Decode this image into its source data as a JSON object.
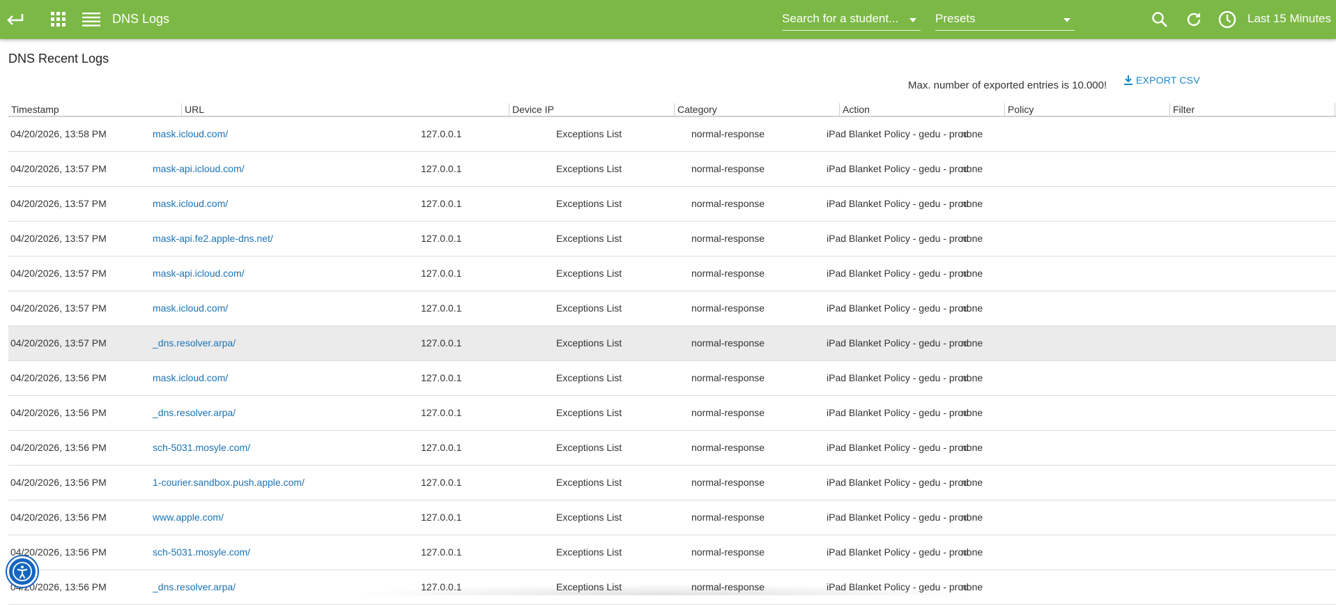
{
  "header": {
    "app_title": "DNS Logs",
    "student_search": {
      "placeholder": "Search for a student..."
    },
    "presets": {
      "value": "Presets"
    },
    "time_range": "Last 15 Minutes",
    "icons": [
      "back-arrow-icon",
      "apps-grid-icon",
      "list-menu-icon",
      "search-icon",
      "refresh-icon",
      "clock-icon"
    ],
    "bar_color": "#7cb845"
  },
  "page": {
    "title": "DNS Recent Logs",
    "export_note": "Max. number of exported entries is 10.000!",
    "export_label": "EXPORT CSV"
  },
  "table": {
    "columns": [
      "Timestamp",
      "URL",
      "Device IP",
      "Category",
      "Action",
      "Policy",
      "Filter"
    ],
    "rows": [
      [
        "04/20/2026, 13:58 PM",
        "mask.icloud.com/",
        "127.0.0.1",
        "Exceptions List",
        "normal-response",
        "iPad Blanket Policy - gedu - prod",
        "none"
      ],
      [
        "04/20/2026, 13:57 PM",
        "mask-api.icloud.com/",
        "127.0.0.1",
        "Exceptions List",
        "normal-response",
        "iPad Blanket Policy - gedu - prod",
        "none"
      ],
      [
        "04/20/2026, 13:57 PM",
        "mask.icloud.com/",
        "127.0.0.1",
        "Exceptions List",
        "normal-response",
        "iPad Blanket Policy - gedu - prod",
        "none"
      ],
      [
        "04/20/2026, 13:57 PM",
        "mask-api.fe2.apple-dns.net/",
        "127.0.0.1",
        "Exceptions List",
        "normal-response",
        "iPad Blanket Policy - gedu - prod",
        "none"
      ],
      [
        "04/20/2026, 13:57 PM",
        "mask-api.icloud.com/",
        "127.0.0.1",
        "Exceptions List",
        "normal-response",
        "iPad Blanket Policy - gedu - prod",
        "none"
      ],
      [
        "04/20/2026, 13:57 PM",
        "mask.icloud.com/",
        "127.0.0.1",
        "Exceptions List",
        "normal-response",
        "iPad Blanket Policy - gedu - prod",
        "none"
      ],
      [
        "04/20/2026, 13:57 PM",
        "_dns.resolver.arpa/",
        "127.0.0.1",
        "Exceptions List",
        "normal-response",
        "iPad Blanket Policy - gedu - prod",
        "none"
      ],
      [
        "04/20/2026, 13:56 PM",
        "mask.icloud.com/",
        "127.0.0.1",
        "Exceptions List",
        "normal-response",
        "iPad Blanket Policy - gedu - prod",
        "none"
      ],
      [
        "04/20/2026, 13:56 PM",
        "_dns.resolver.arpa/",
        "127.0.0.1",
        "Exceptions List",
        "normal-response",
        "iPad Blanket Policy - gedu - prod",
        "none"
      ],
      [
        "04/20/2026, 13:56 PM",
        "sch-5031.mosyle.com/",
        "127.0.0.1",
        "Exceptions List",
        "normal-response",
        "iPad Blanket Policy - gedu - prod",
        "none"
      ],
      [
        "04/20/2026, 13:56 PM",
        "1-courier.sandbox.push.apple.com/",
        "127.0.0.1",
        "Exceptions List",
        "normal-response",
        "iPad Blanket Policy - gedu - prod",
        "none"
      ],
      [
        "04/20/2026, 13:56 PM",
        "www.apple.com/",
        "127.0.0.1",
        "Exceptions List",
        "normal-response",
        "iPad Blanket Policy - gedu - prod",
        "none"
      ],
      [
        "04/20/2026, 13:56 PM",
        "sch-5031.mosyle.com/",
        "127.0.0.1",
        "Exceptions List",
        "normal-response",
        "iPad Blanket Policy - gedu - prod",
        "none"
      ],
      [
        "04/20/2026, 13:56 PM",
        "_dns.resolver.arpa/",
        "127.0.0.1",
        "Exceptions List",
        "normal-response",
        "iPad Blanket Policy - gedu - prod",
        "none"
      ]
    ],
    "highlighted_row": 6
  },
  "accessibility": {
    "icon": "accessibility-icon"
  }
}
